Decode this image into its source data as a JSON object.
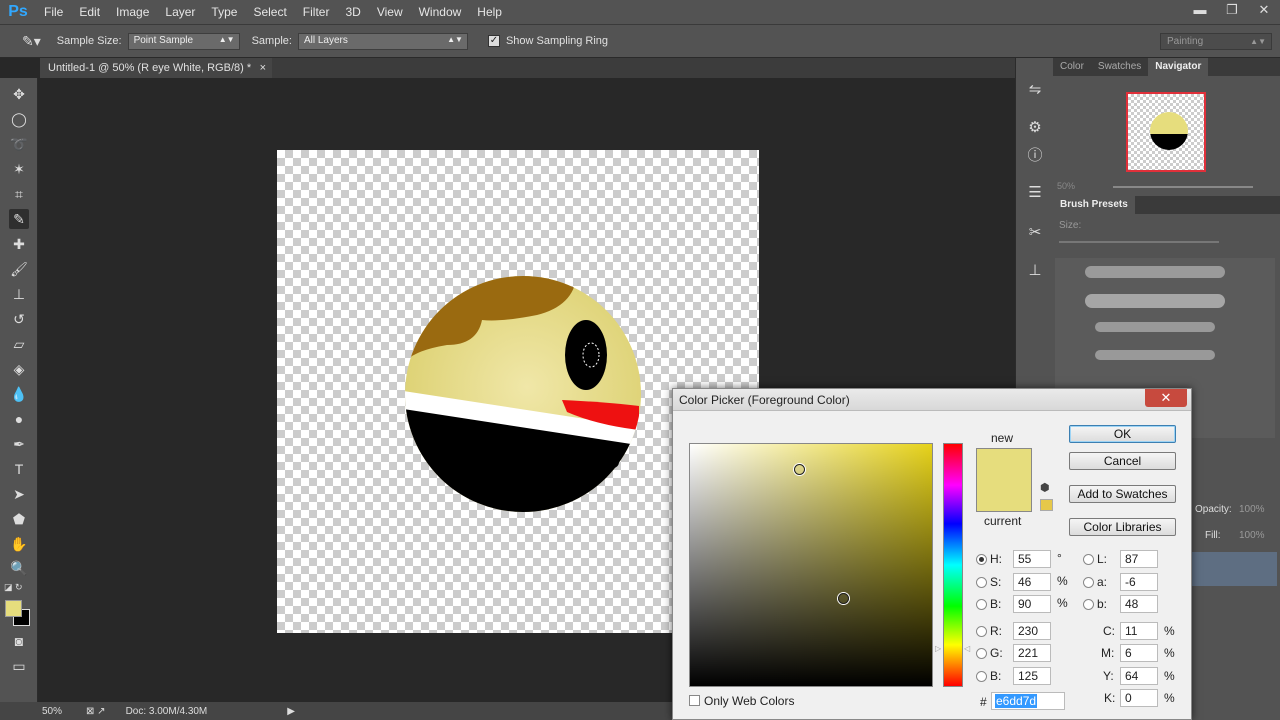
{
  "app": {
    "logo": "Ps"
  },
  "menu": [
    "File",
    "Edit",
    "Image",
    "Layer",
    "Type",
    "Select",
    "Filter",
    "3D",
    "View",
    "Window",
    "Help"
  ],
  "window_controls": {
    "minimize": "▬",
    "restore": "❐",
    "close": "✕"
  },
  "options": {
    "sample_size_label": "Sample Size:",
    "sample_size_value": "Point Sample",
    "sample_label": "Sample:",
    "sample_value": "All Layers",
    "show_ring_label": "Show Sampling Ring",
    "show_ring_checked": true,
    "workspace": "Painting"
  },
  "document": {
    "tab_title": "Untitled-1 @ 50% (R eye White, RGB/8) *",
    "tab_close": "×"
  },
  "status": {
    "zoom": "50%",
    "doc": "Doc: 3.00M/4.30M"
  },
  "panels": {
    "top_tabs": [
      "Color",
      "Swatches",
      "Navigator"
    ],
    "navigator_zoom": "50%",
    "brush_presets_title": "Brush Presets",
    "size_label": "Size:",
    "opacity_label": "Opacity:",
    "opacity_value": "100%",
    "fill_label": "Fill:",
    "fill_value": "100%"
  },
  "dialog": {
    "title": "Color Picker (Foreground Color)",
    "close": "✕",
    "new_label": "new",
    "current_label": "current",
    "new_color": "#e6dd7d",
    "current_color": "#e6dd7d",
    "ok": "OK",
    "cancel": "Cancel",
    "add_swatches": "Add to Swatches",
    "color_libraries": "Color Libraries",
    "only_web_colors": "Only Web Colors",
    "hex_label": "#",
    "hex": "e6dd7d",
    "hsb": [
      {
        "label": "H:",
        "value": "55",
        "unit": "°",
        "selected": true
      },
      {
        "label": "S:",
        "value": "46",
        "unit": "%",
        "selected": false
      },
      {
        "label": "B:",
        "value": "90",
        "unit": "%",
        "selected": false
      }
    ],
    "rgb": [
      {
        "label": "R:",
        "value": "230"
      },
      {
        "label": "G:",
        "value": "221"
      },
      {
        "label": "B:",
        "value": "125"
      }
    ],
    "lab": [
      {
        "label": "L:",
        "value": "87"
      },
      {
        "label": "a:",
        "value": "-6"
      },
      {
        "label": "b:",
        "value": "48"
      }
    ],
    "cmyk": [
      {
        "label": "C:",
        "value": "11",
        "unit": "%"
      },
      {
        "label": "M:",
        "value": "6",
        "unit": "%"
      },
      {
        "label": "Y:",
        "value": "64",
        "unit": "%"
      },
      {
        "label": "K:",
        "value": "0",
        "unit": "%"
      }
    ]
  },
  "colors": {
    "foreground": "#e6dd7d",
    "background": "#000000",
    "character_face": "#e8dd85",
    "hair": "#9a6a10",
    "mouth": "#ee1111"
  }
}
